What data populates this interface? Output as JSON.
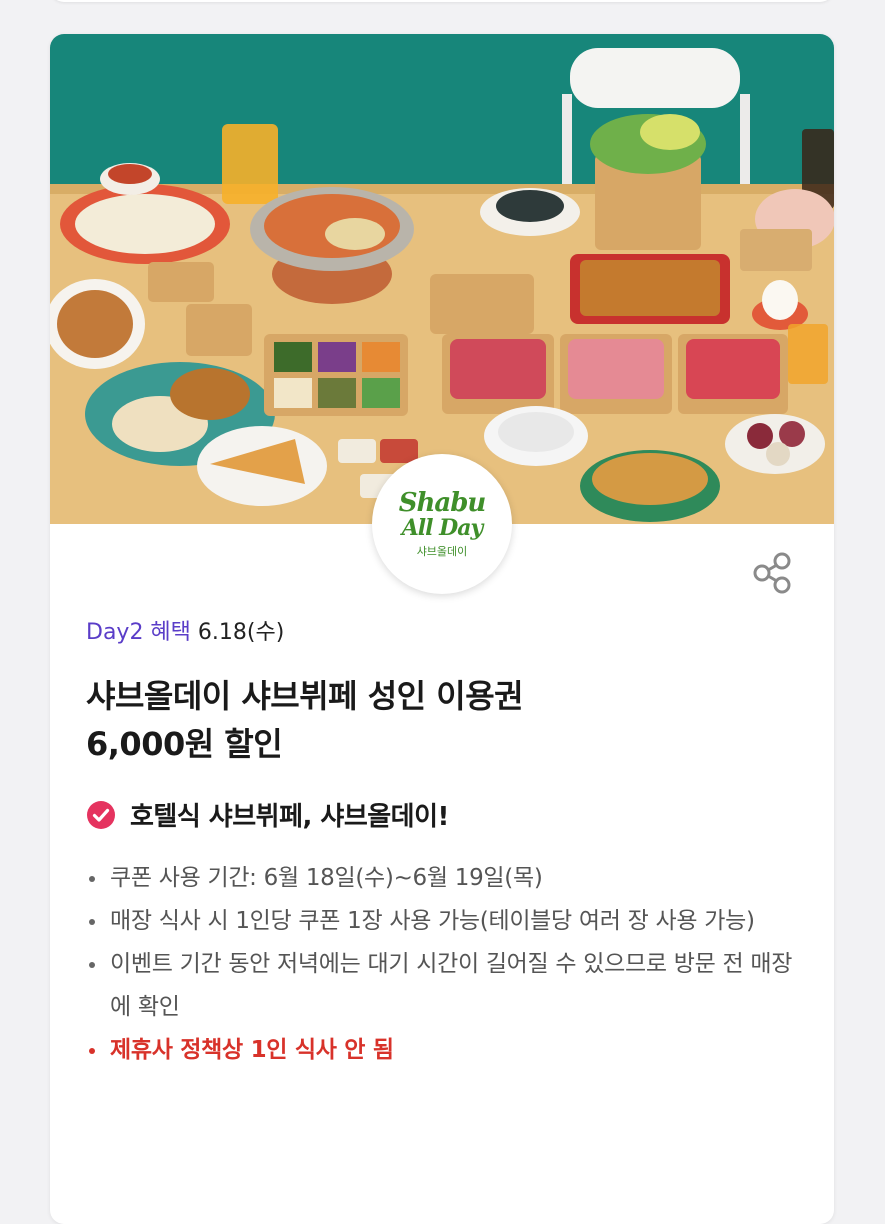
{
  "colors": {
    "accent_purple": "#5a3dc8",
    "warning_red": "#d8322a",
    "check_pink": "#e5335f",
    "logo_green": "#3f8f2a",
    "hero_teal": "#17867a",
    "hero_table": "#e7c07e"
  },
  "hero": {
    "image_semantic": "shabu-buffet-food-spread-photo",
    "logo": {
      "line1": "Shabu",
      "line2": "All Day",
      "sub": "샤브올데이"
    }
  },
  "share_icon": "share-icon",
  "benefit": {
    "day_tag": "Day2 혜택",
    "date": "6.18(수)"
  },
  "title": {
    "line1": "샤브올데이 샤브뷔페 성인 이용권",
    "line2": "6,000원 할인"
  },
  "headline": {
    "icon": "check-circle-icon",
    "text": "호텔식 샤브뷔페, 샤브올데이!"
  },
  "details": [
    "쿠폰 사용 기간: 6월 18일(수)~6월 19일(목)",
    "매장 식사 시 1인당 쿠폰 1장 사용 가능(테이블당 여러 장 사용 가능)",
    "이벤트 기간 동안 저녁에는 대기 시간이 길어질 수 있으므로 방문 전 매장에 확인",
    "제휴사 정책상 1인 식사 안 됨"
  ]
}
